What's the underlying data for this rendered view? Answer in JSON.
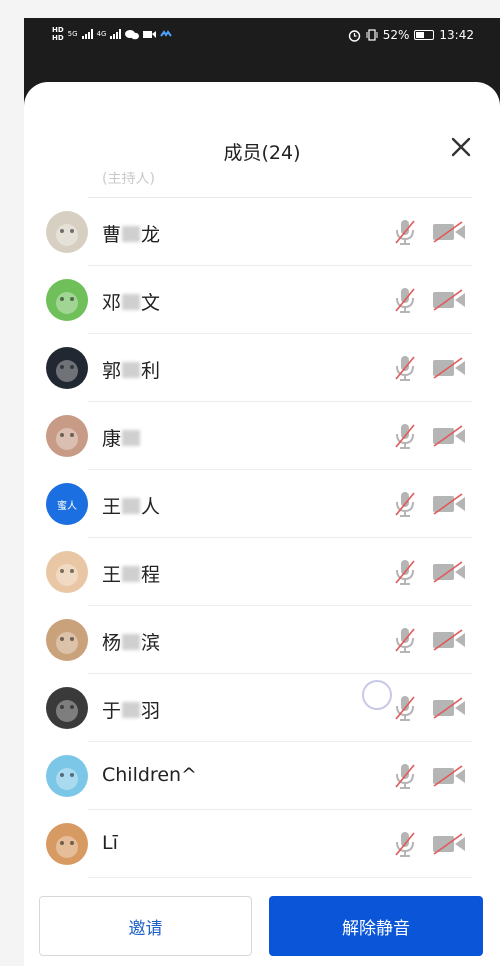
{
  "status_bar": {
    "network_left": "HD",
    "signal_a": "5G",
    "signal_b": "4G",
    "battery_percent": "52%",
    "battery_level": 0.52,
    "time": "13:42"
  },
  "panel": {
    "title": "成员(24)",
    "partial_row_text": "(主持人)"
  },
  "members": [
    {
      "name_parts": [
        "曹",
        "龙"
      ],
      "avatar": "cat",
      "avatar_color": "#d8cfc3"
    },
    {
      "name_parts": [
        "邓",
        "文"
      ],
      "avatar": "green-scene",
      "avatar_color": "#6fbf5a"
    },
    {
      "name_parts": [
        "郭",
        "利"
      ],
      "avatar": "dark-photo",
      "avatar_color": "#222831"
    },
    {
      "name_parts": [
        "康",
        ""
      ],
      "avatar": "figure",
      "avatar_color": "#c79b86"
    },
    {
      "name_parts": [
        "王",
        "人"
      ],
      "avatar": "text-badge",
      "avatar_color": "#1b6fe0",
      "avatar_text": "蜜人"
    },
    {
      "name_parts": [
        "王",
        "程"
      ],
      "avatar": "dog-white",
      "avatar_color": "#e9c7a4"
    },
    {
      "name_parts": [
        "杨",
        "滨"
      ],
      "avatar": "dog-brown",
      "avatar_color": "#c9a27c"
    },
    {
      "name_parts": [
        "于",
        "羽"
      ],
      "avatar": "dog-black",
      "avatar_color": "#3a3a3a"
    },
    {
      "name_parts": [
        "Children^"
      ],
      "avatar": "kids",
      "avatar_color": "#7cc6e8"
    },
    {
      "name_parts": [
        "Lī"
      ],
      "avatar": "sunset",
      "avatar_color": "#d89a63"
    }
  ],
  "buttons": {
    "invite": "邀请",
    "unmute_all": "解除静音"
  },
  "colors": {
    "accent": "#0b55d8",
    "muted_icon": "#b5b5b5",
    "mute_slash": "#e05a5a"
  }
}
